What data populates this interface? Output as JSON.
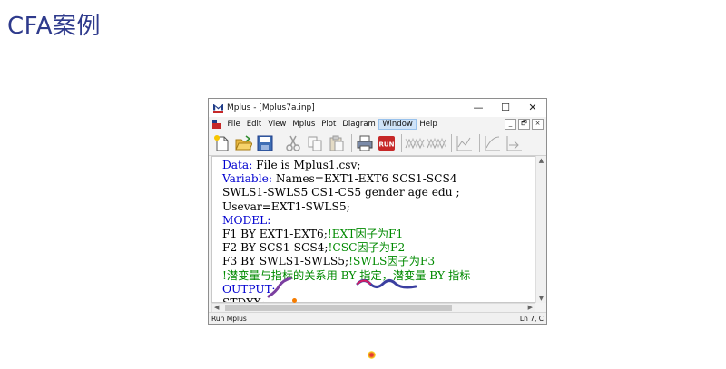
{
  "slide": {
    "title": "CFA案例"
  },
  "window": {
    "title": "Mplus - [Mplus7a.inp]",
    "controls": {
      "minimize": "—",
      "maximize": "☐",
      "close": "✕"
    }
  },
  "menu": {
    "items": [
      "File",
      "Edit",
      "View",
      "Mplus",
      "Plot",
      "Diagram",
      "Window",
      "Help"
    ],
    "active": "Window",
    "mdi": {
      "minimize": "_",
      "restore": "🗗",
      "close": "×"
    }
  },
  "toolbar": {
    "icons": [
      "new-icon",
      "open-icon",
      "save-icon",
      "cut-icon",
      "copy-icon",
      "paste-icon",
      "print-icon",
      "run-icon",
      "plot-icon-1",
      "plot-icon-2",
      "plot-icon-3",
      "plot-icon-4",
      "plot-icon-5"
    ],
    "run_label": "RUN"
  },
  "editor": {
    "lines": [
      [
        {
          "t": "Data:",
          "c": "kw"
        },
        {
          "t": " File is Mplus1.csv;",
          "c": ""
        }
      ],
      [
        {
          "t": "Variable:",
          "c": "kw"
        },
        {
          "t": " Names=EXT1-EXT6 SCS1-SCS4",
          "c": ""
        }
      ],
      [
        {
          "t": "SWLS1-SWLS5 CS1-CS5 gender age edu ;",
          "c": ""
        }
      ],
      [
        {
          "t": "Usevar=EXT1-SWLS5;",
          "c": ""
        }
      ],
      [
        {
          "t": "MODEL:",
          "c": "kw"
        }
      ],
      [
        {
          "t": "F1 BY EXT1-EXT6;",
          "c": ""
        },
        {
          "t": "!EXT因子为F1",
          "c": "cm"
        }
      ],
      [
        {
          "t": "F2 BY SCS1-SCS4;",
          "c": ""
        },
        {
          "t": "!CSC因子为F2",
          "c": "cm"
        }
      ],
      [
        {
          "t": "F3 BY SWLS1-SWLS5;",
          "c": ""
        },
        {
          "t": "!SWLS因子为F3",
          "c": "cm"
        }
      ],
      [
        {
          "t": "!潜变量与指标的关系用 BY 指定，潜变量 BY 指标",
          "c": "cm"
        }
      ],
      [
        {
          "t": "OUTPUT:",
          "c": "kw"
        }
      ],
      [
        {
          "t": "STDYX;",
          "c": ""
        }
      ]
    ]
  },
  "status": {
    "left": "Run Mplus",
    "right": "Ln 7, C"
  },
  "colors": {
    "keyword": "#0000d0",
    "comment": "#008a00",
    "slide_title": "#2e3a8c"
  }
}
